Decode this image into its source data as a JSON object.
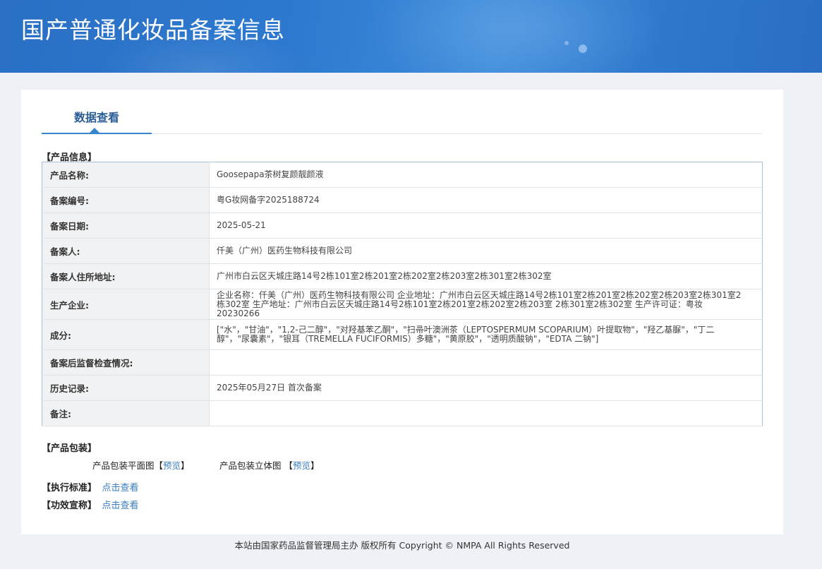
{
  "header": {
    "title": "国产普通化妆品备案信息"
  },
  "tab": {
    "label": "数据查看"
  },
  "sections": {
    "product_info": "【产品信息】",
    "packaging": "【产品包装】",
    "standard": "【执行标准】",
    "efficacy": "【功效宣称】"
  },
  "product_info": {
    "rows": [
      {
        "label": "产品名称:",
        "value": "Goosepapa茶树复颜靓颜液"
      },
      {
        "label": "备案编号:",
        "value": "粤G妆网备字2025188724"
      },
      {
        "label": "备案日期:",
        "value": "2025-05-21"
      },
      {
        "label": "备案人:",
        "value": "仟美（广州）医药生物科技有限公司"
      },
      {
        "label": "备案人住所地址:",
        "value": "广州市白云区天城庄路14号2栋101室2栋201室2栋202室2栋203室2栋301室2栋302室"
      },
      {
        "label": "生产企业:",
        "value": "企业名称：仟美（广州）医药生物科技有限公司 企业地址：广州市白云区天城庄路14号2栋101室2栋201室2栋202室2栋203室2栋301室2栋302室 生产地址：广州市白云区天城庄路14号2栋101室2栋201室2栋202室2栋203室 2栋301室2栋302室 生产许可证：粤妆20230266"
      },
      {
        "label": "成分:",
        "value": "[\"水\"，\"甘油\"，\"1,2-己二醇\"，\"对羟基苯乙酮\"，\"扫帚叶澳洲茶（LEPTOSPERMUM SCOPARIUM）叶提取物\"，\"羟乙基脲\"，\"丁二醇\"，\"尿囊素\"，\"银耳（TREMELLA FUCIFORMIS）多糖\"，\"黄原胶\"，\"透明质酸钠\"，\"EDTA 二钠\"]"
      },
      {
        "label": "备案后监督检查情况:",
        "value": ""
      },
      {
        "label": "历史记录:",
        "value": "2025年05月27日 首次备案"
      },
      {
        "label": "备注:",
        "value": ""
      }
    ]
  },
  "packaging": {
    "flat_label": "产品包装平面图",
    "flat_link": "预览",
    "solid_label": "产品包装立体图",
    "solid_link": "预览"
  },
  "standard_link": "点击查看",
  "efficacy_link": "点击查看",
  "footer": {
    "text": "本站由国家药品监督管理局主办 版权所有 Copyright © NMPA All Rights Reserved"
  }
}
